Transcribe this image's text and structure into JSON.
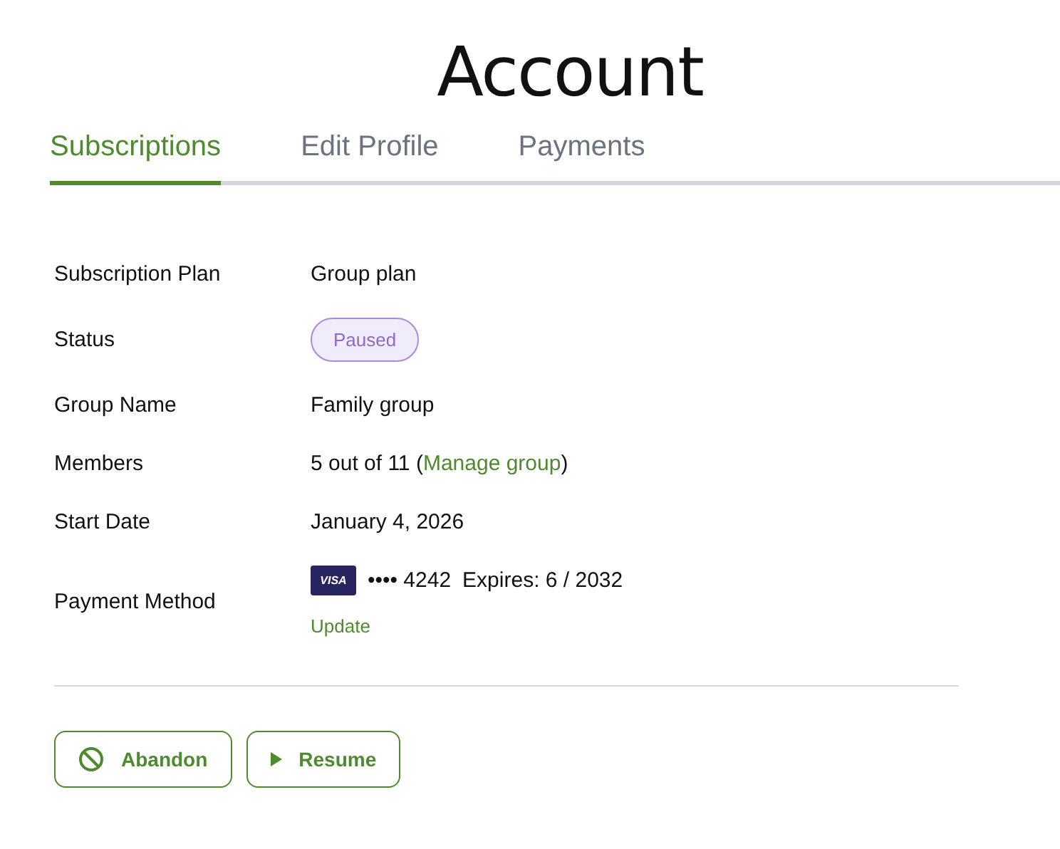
{
  "title": "Account",
  "tabs": [
    {
      "label": "Subscriptions",
      "selected": true
    },
    {
      "label": "Edit Profile",
      "selected": false
    },
    {
      "label": "Payments",
      "selected": false
    }
  ],
  "details": [
    {
      "kind": "text",
      "label": "Subscription Plan",
      "value": "Group plan"
    },
    {
      "kind": "badge",
      "label": "Status",
      "value": "Paused"
    },
    {
      "kind": "text",
      "label": "Group Name",
      "value": "Family group"
    },
    {
      "kind": "members",
      "label": "Members",
      "value": "5 out of 11 (",
      "link": "Manage group",
      "suffix": ")"
    },
    {
      "kind": "text",
      "label": "Start Date",
      "value": "January 4, 2026"
    },
    {
      "kind": "payment",
      "label": "Payment Method",
      "brand": "VISA",
      "number": "•••• 4242",
      "expires": "Expires: 6 / 2032",
      "link": "Update"
    }
  ],
  "actions": [
    {
      "kind": "abandon",
      "label": "Abandon"
    },
    {
      "kind": "resume",
      "label": "Resume"
    }
  ]
}
